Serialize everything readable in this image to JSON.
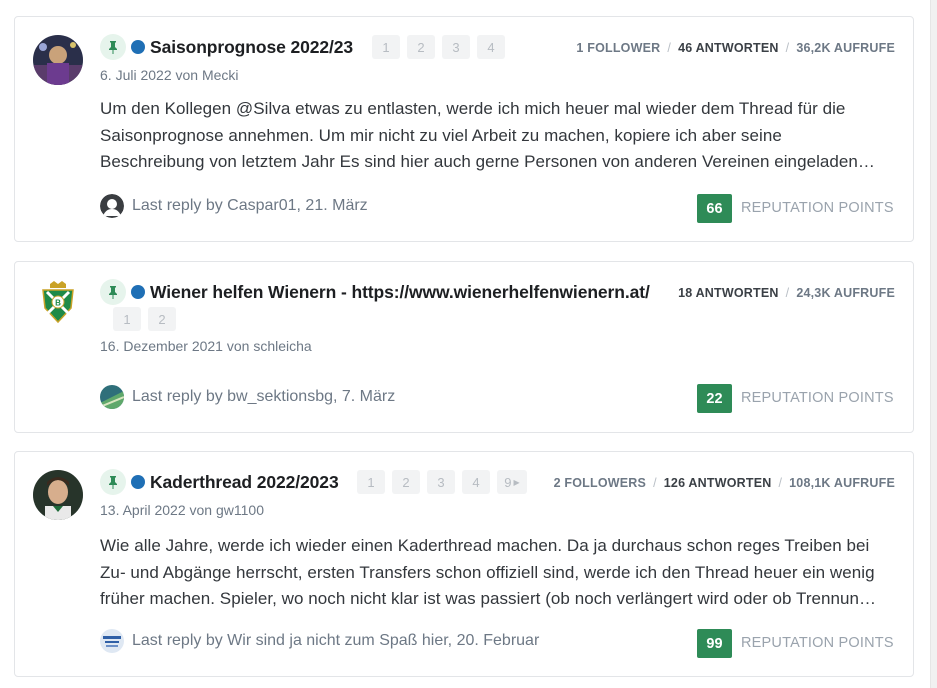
{
  "threads": [
    {
      "title": "Saisonprognose 2022/23",
      "pages": [
        "1",
        "2",
        "3",
        "4"
      ],
      "followers": "1 FOLLOWER",
      "replies": "46 ANTWORTEN",
      "views": "36,2K AUFRUFE",
      "meta": "6. Juli 2022 von Mecki",
      "excerpt": [
        "Um den Kollegen @Silva etwas zu entlasten, werde ich mich heuer mal wieder dem Thread für die",
        "Saisonprognose annehmen. Um mir nicht zu viel Arbeit zu machen, kopiere ich aber seine",
        "Beschreibung von letztem Jahr Es sind hier auch gerne Personen von anderen Vereinen eingeladen…"
      ],
      "last_reply": "Last reply by Caspar01, 21. März",
      "reputation": "66",
      "reputation_label": "REPUTATION POINTS",
      "avatar_icon": "user-avatar-photo",
      "reply_avatar_icon": "default-user-avatar-icon"
    },
    {
      "title": "Wiener helfen Wienern - https://www.wienerhelfenwienern.at/",
      "pages": [
        "1",
        "2"
      ],
      "replies": "18 ANTWORTEN",
      "views": "24,3K AUFRUFE",
      "meta": "16. Dezember 2021 von schleicha",
      "last_reply": "Last reply by bw_sektionsbg, 7. März",
      "reputation": "22",
      "reputation_label": "REPUTATION POINTS",
      "avatar_icon": "club-crest-avatar",
      "reply_avatar_icon": "user-avatar-photo"
    },
    {
      "title": "Kaderthread 2022/2023",
      "pages": [
        "1",
        "2",
        "3",
        "4",
        "9"
      ],
      "followers": "2 FOLLOWERS",
      "replies": "126 ANTWORTEN",
      "views": "108,1K AUFRUFE",
      "meta": "13. April 2022 von gw1100",
      "excerpt": [
        "Wie alle Jahre, werde ich wieder einen Kaderthread machen. Da ja durchaus schon reges Treiben bei",
        "Zu- und Abgänge herrscht, ersten Transfers schon offiziell sind, werde ich den Thread heuer ein wenig",
        "früher machen. Spieler, wo noch nicht klar ist was passiert (ob noch verlängert wird oder ob Trennun…"
      ],
      "last_reply": "Last reply by Wir sind ja nicht zum Spaß hier, 20. Februar",
      "reputation": "99",
      "reputation_label": "REPUTATION POINTS",
      "avatar_icon": "user-avatar-photo",
      "reply_avatar_icon": "user-avatar-photo"
    }
  ],
  "colors": {
    "accent_green": "#2e8b57",
    "online_dot": "#1f6fb5",
    "pin_bg": "#e6f4ec"
  }
}
